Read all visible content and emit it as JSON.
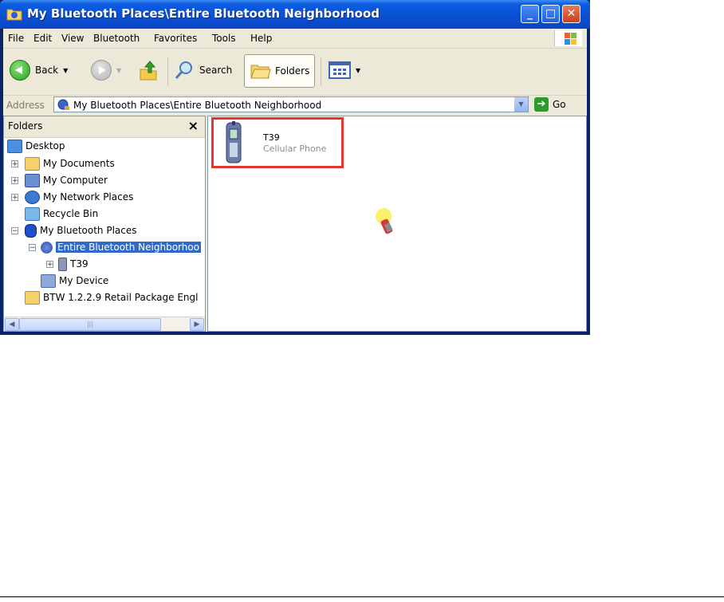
{
  "window": {
    "title": "My Bluetooth Places\\Entire Bluetooth Neighborhood",
    "controls": [
      "minimize",
      "maximize",
      "close"
    ]
  },
  "menu": {
    "items": [
      "File",
      "Edit",
      "View",
      "Bluetooth",
      "Favorites",
      "Tools",
      "Help"
    ]
  },
  "toolbar": {
    "back_label": "Back",
    "search_label": "Search",
    "folders_label": "Folders"
  },
  "address": {
    "label": "Address",
    "value": "My Bluetooth Places\\Entire Bluetooth Neighborhood",
    "go_label": "Go"
  },
  "folders_pane": {
    "title": "Folders",
    "tree": [
      {
        "label": "Desktop",
        "level": 0,
        "expander": "none",
        "icon": "desktop-icon"
      },
      {
        "label": "My Documents",
        "level": 1,
        "expander": "+",
        "icon": "my-documents-icon"
      },
      {
        "label": "My Computer",
        "level": 1,
        "expander": "+",
        "icon": "my-computer-icon"
      },
      {
        "label": "My Network Places",
        "level": 1,
        "expander": "+",
        "icon": "network-places-icon"
      },
      {
        "label": "Recycle Bin",
        "level": 1,
        "expander": "none",
        "icon": "recycle-bin-icon"
      },
      {
        "label": "My Bluetooth Places",
        "level": 1,
        "expander": "-",
        "icon": "bluetooth-icon"
      },
      {
        "label": "Entire Bluetooth Neighborhoo",
        "level": 2,
        "expander": "-",
        "icon": "bluetooth-neighborhood-icon",
        "selected": true
      },
      {
        "label": "T39",
        "level": 3,
        "expander": "+",
        "icon": "cellphone-icon"
      },
      {
        "label": "My Device",
        "level": 2,
        "expander": "none",
        "icon": "my-device-icon"
      },
      {
        "label": "BTW 1.2.2.9 Retail Package Engl",
        "level": 1,
        "expander": "none",
        "icon": "folder-icon"
      }
    ]
  },
  "content": {
    "items": [
      {
        "name": "T39",
        "type": "Cellular Phone",
        "icon": "cellphone-icon"
      }
    ],
    "cursor": "bluetooth-searching-icon"
  },
  "colors": {
    "titlebar": "#0a4fd0",
    "selection": "#316ac5",
    "highlight_border": "#e0362b",
    "chrome": "#ece9d8"
  }
}
